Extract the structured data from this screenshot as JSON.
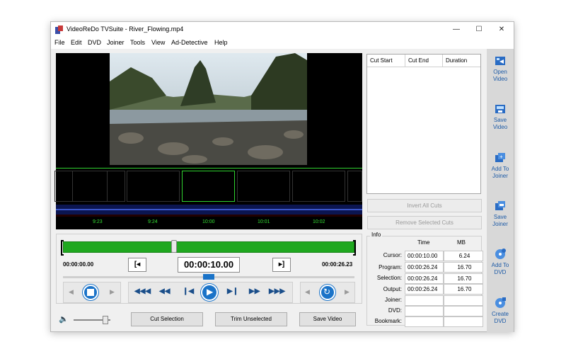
{
  "window": {
    "title": "VideoReDo TVSuite - River_Flowing.mp4",
    "minimize": "—",
    "maximize": "☐",
    "close": "✕"
  },
  "menu": [
    "File",
    "Edit",
    "DVD",
    "Joiner",
    "Tools",
    "View",
    "Ad-Detective",
    "Help"
  ],
  "strip": {
    "ticks": [
      "9:23",
      "9:24",
      "10:00",
      "10:01",
      "10:02"
    ]
  },
  "cuts": {
    "headers": [
      "Cut Start",
      "Cut End",
      "Duration"
    ],
    "invert_label": "Invert All Cuts",
    "remove_label": "Remove Selected Cuts"
  },
  "info": {
    "title": "Info",
    "col_time": "Time",
    "col_mb": "MB",
    "rows": [
      {
        "label": "Cursor:",
        "time": "00:00:10.00",
        "mb": "6.24"
      },
      {
        "label": "Program:",
        "time": "00:00:26.24",
        "mb": "16.70"
      },
      {
        "label": "Selection:",
        "time": "00:00:26.24",
        "mb": "16.70"
      },
      {
        "label": "Output:",
        "time": "00:00:26.24",
        "mb": "16.70"
      },
      {
        "label": "Joiner:",
        "time": "",
        "mb": ""
      },
      {
        "label": "DVD:",
        "time": "",
        "mb": ""
      },
      {
        "label": "Bookmark:",
        "time": "",
        "mb": ""
      }
    ]
  },
  "sidebar": [
    {
      "label": "Open\nVideo",
      "icon": "open-video-icon"
    },
    {
      "label": "Save\nVideo",
      "icon": "save-video-icon"
    },
    {
      "label": "Add To\nJoiner",
      "icon": "add-joiner-icon"
    },
    {
      "label": "Save\nJoiner",
      "icon": "save-joiner-icon"
    },
    {
      "label": "Add To\nDVD",
      "icon": "add-dvd-icon"
    },
    {
      "label": "Create\nDVD",
      "icon": "create-dvd-icon"
    }
  ],
  "playback": {
    "start_time": "00:00:00.00",
    "current_time": "00:00:10.00",
    "end_time": "00:00:26.23",
    "position_fraction": 0.38,
    "mark_start": "[◂",
    "mark_end": "▸]"
  },
  "buttons": {
    "cut_selection": "Cut Selection",
    "trim_unselected": "Trim Unselected",
    "save_video": "Save Video"
  },
  "colors": {
    "accent": "#1a73c8",
    "timeline": "#1fa81f",
    "tick": "#34e034"
  }
}
